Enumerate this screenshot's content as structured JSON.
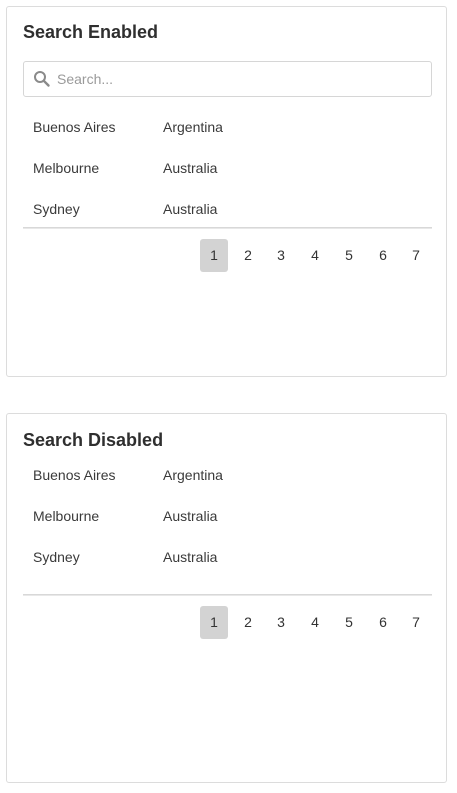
{
  "panels": [
    {
      "title": "Search Enabled",
      "search": {
        "placeholder": "Search...",
        "value": ""
      },
      "rows": [
        {
          "city": "Buenos Aires",
          "country": "Argentina"
        },
        {
          "city": "Melbourne",
          "country": "Australia"
        },
        {
          "city": "Sydney",
          "country": "Australia"
        }
      ],
      "pages": [
        "1",
        "2",
        "3",
        "4",
        "5",
        "6",
        "7"
      ],
      "current_page": "1"
    },
    {
      "title": "Search Disabled",
      "rows": [
        {
          "city": "Buenos Aires",
          "country": "Argentina"
        },
        {
          "city": "Melbourne",
          "country": "Australia"
        },
        {
          "city": "Sydney",
          "country": "Australia"
        }
      ],
      "pages": [
        "1",
        "2",
        "3",
        "4",
        "5",
        "6",
        "7"
      ],
      "current_page": "1"
    }
  ],
  "icons": {
    "search": "search-icon"
  },
  "colors": {
    "active_page_bg": "#d3d3d3",
    "border": "#dcdcdc",
    "text": "#333333"
  }
}
